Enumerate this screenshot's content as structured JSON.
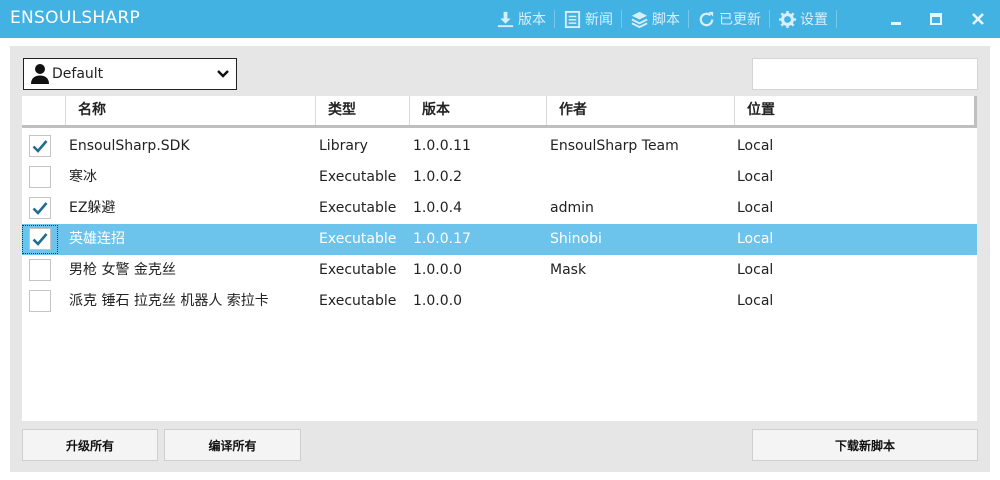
{
  "app": {
    "title": "ENSOULSHARP"
  },
  "titlebar": {
    "actions": [
      {
        "label": "版本",
        "icon": "download-icon"
      },
      {
        "label": "新闻",
        "icon": "news-icon"
      },
      {
        "label": "脚本",
        "icon": "layers-icon"
      },
      {
        "label": "已更新",
        "icon": "refresh-icon"
      },
      {
        "label": "设置",
        "icon": "gear-icon"
      }
    ]
  },
  "profile": {
    "selected": "Default",
    "icon": "user-icon"
  },
  "search": {
    "value": "",
    "placeholder": ""
  },
  "table": {
    "headers": {
      "name": "名称",
      "type": "类型",
      "version": "版本",
      "author": "作者",
      "location": "位置"
    },
    "rows": [
      {
        "checked": true,
        "name": "EnsoulSharp.SDK",
        "type": "Library",
        "version": "1.0.0.11",
        "author": "EnsoulSharp Team",
        "location": "Local"
      },
      {
        "checked": false,
        "name": "寒冰",
        "type": "Executable",
        "version": "1.0.0.2",
        "author": "",
        "location": "Local"
      },
      {
        "checked": true,
        "name": "EZ躲避",
        "type": "Executable",
        "version": "1.0.0.4",
        "author": "admin",
        "location": "Local"
      },
      {
        "checked": true,
        "name": "英雄连招",
        "type": "Executable",
        "version": "1.0.0.17",
        "author": "Shinobi",
        "location": "Local",
        "selected": true
      },
      {
        "checked": false,
        "name": "男枪 女警 金克丝",
        "type": "Executable",
        "version": "1.0.0.0",
        "author": "Mask",
        "location": "Local"
      },
      {
        "checked": false,
        "name": "派克 锤石 拉克丝 机器人 索拉卡",
        "type": "Executable",
        "version": "1.0.0.0",
        "author": "",
        "location": "Local"
      }
    ]
  },
  "buttons": {
    "upgrade_all": "升级所有",
    "compile_all": "编译所有",
    "download_new": "下载新脚本"
  },
  "colors": {
    "titlebar": "#41b2e2",
    "selected_row": "#6cc4ec",
    "check_mark": "#1f6e91"
  }
}
